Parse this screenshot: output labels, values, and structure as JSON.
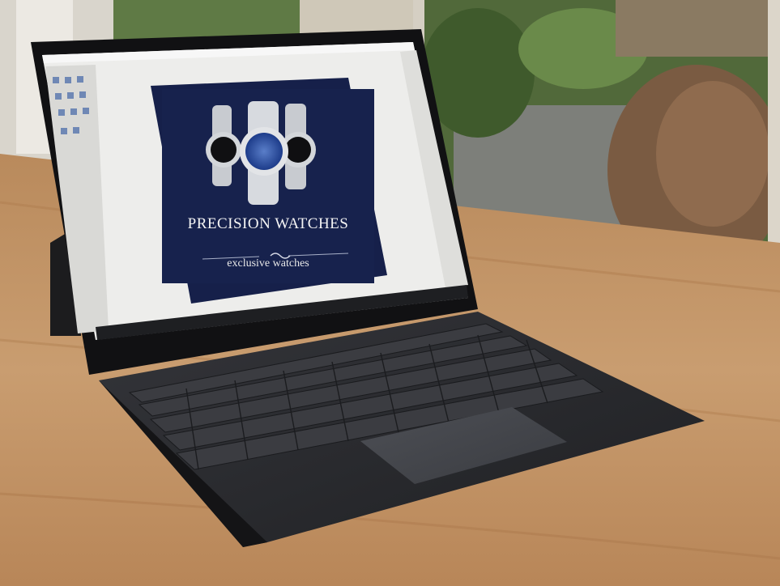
{
  "photo": {
    "subject": "tablet-laptop-with-detachable-keyboard",
    "colors": {
      "table_wood": "#c69a6c",
      "keyboard": "#2a2b2e",
      "bezel": "#121214",
      "poster_navy": "#16204a",
      "garden_green": "#4f6b3a",
      "wall_white": "#e9e6df"
    }
  },
  "screen": {
    "app": "image-editor",
    "poster": {
      "title": "PRECISION WATCHES",
      "subtitle": "exclusive watches"
    }
  }
}
